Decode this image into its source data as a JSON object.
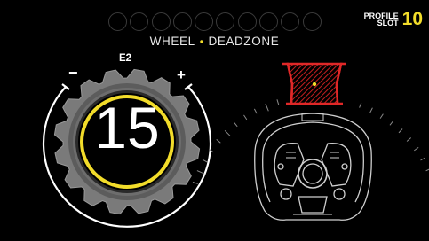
{
  "header": {
    "mode": "WHEEL",
    "separator": "•",
    "setting": "DEADZONE",
    "leds_count": 10
  },
  "profile": {
    "label_line1": "PROFILE",
    "label_line2": "SLOT",
    "slot_number": "10"
  },
  "dial": {
    "mode_label": "E2",
    "value": "15",
    "minus_label": "−",
    "plus_label": "+"
  },
  "colors": {
    "accent": "#f2dc2a",
    "deadzone": "#d42323",
    "led_off": "#3a3a3a"
  },
  "icons": [
    "minus-icon",
    "plus-icon",
    "steering-wheel-icon",
    "deadzone-indicator-icon"
  ]
}
